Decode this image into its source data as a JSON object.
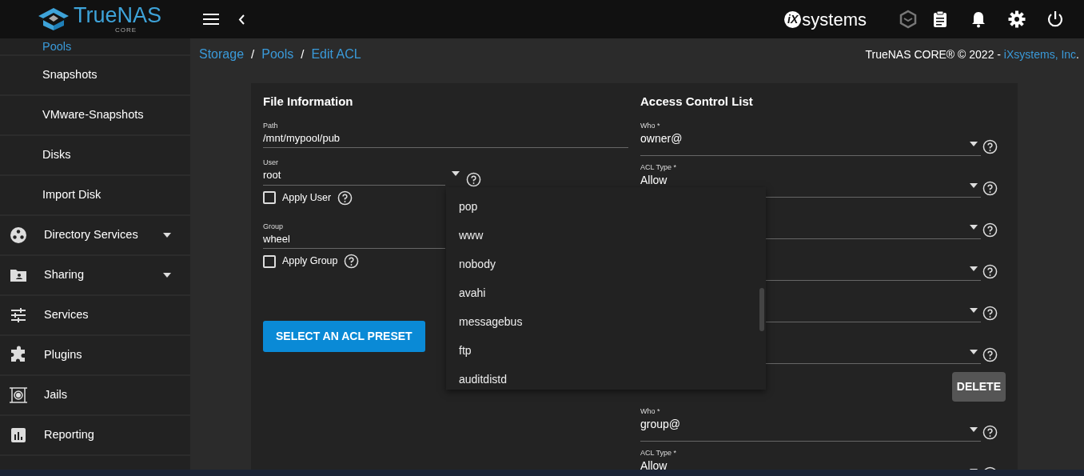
{
  "header": {
    "logo_text": "True**NAS**",
    "logo_sub": "CORE",
    "vendor_mark": "iX",
    "vendor_text": "systems"
  },
  "sidebar": {
    "items": [
      {
        "label": "Pools",
        "kind": "sub",
        "selected": true
      },
      {
        "label": "Snapshots",
        "kind": "sub",
        "selected": false
      },
      {
        "label": "VMware-Snapshots",
        "kind": "sub",
        "selected": false
      },
      {
        "label": "Disks",
        "kind": "sub",
        "selected": false
      },
      {
        "label": "Import Disk",
        "kind": "sub",
        "selected": false
      },
      {
        "label": "Directory Services",
        "kind": "directory",
        "selected": false,
        "expanded": false
      },
      {
        "label": "Sharing",
        "kind": "sharing",
        "selected": false,
        "expanded": false
      },
      {
        "label": "Services",
        "kind": "services",
        "selected": false
      },
      {
        "label": "Plugins",
        "kind": "plugins",
        "selected": false
      },
      {
        "label": "Jails",
        "kind": "jails",
        "selected": false
      },
      {
        "label": "Reporting",
        "kind": "reporting",
        "selected": false
      }
    ]
  },
  "breadcrumb": {
    "separator": "/",
    "items": [
      "Storage",
      "Pools",
      "Edit ACL"
    ]
  },
  "copyright": {
    "text": "TrueNAS CORE® © 2022 - ",
    "link": "iXsystems, Inc",
    "end": "."
  },
  "file_information": {
    "title": "File Information",
    "path": {
      "label": "Path",
      "value": "/mnt/mypool/pub"
    },
    "user": {
      "label": "User",
      "value": "root",
      "expanded": true
    },
    "apply_user": {
      "label": "Apply User",
      "checked": false
    },
    "group": {
      "label": "Group",
      "value": "wheel"
    },
    "apply_group": {
      "label": "Apply Group",
      "checked": false
    },
    "preset_button": "SELECT AN ACL PRESET"
  },
  "user_options": [
    {
      "label": "pop",
      "selected": false
    },
    {
      "label": "www",
      "selected": false
    },
    {
      "label": "nobody",
      "selected": false
    },
    {
      "label": "avahi",
      "selected": false
    },
    {
      "label": "messagebus",
      "selected": false
    },
    {
      "label": "ftp",
      "selected": false
    },
    {
      "label": "auditdistd",
      "selected": false
    }
  ],
  "access_control_list": {
    "title": "Access Control List",
    "entries": [
      {
        "fields": [
          {
            "kind": "select",
            "label": "Who *",
            "value": "owner@"
          },
          {
            "kind": "select",
            "label": "ACL Type *",
            "value": "Allow"
          },
          {
            "kind": "covered"
          },
          {
            "kind": "covered"
          },
          {
            "kind": "covered"
          },
          {
            "kind": "covered"
          }
        ],
        "delete_button": "DELETE"
      },
      {
        "fields": [
          {
            "kind": "select",
            "label": "Who *",
            "value": "group@"
          },
          {
            "kind": "select",
            "label": "ACL Type *",
            "value": "Allow"
          }
        ]
      }
    ]
  }
}
